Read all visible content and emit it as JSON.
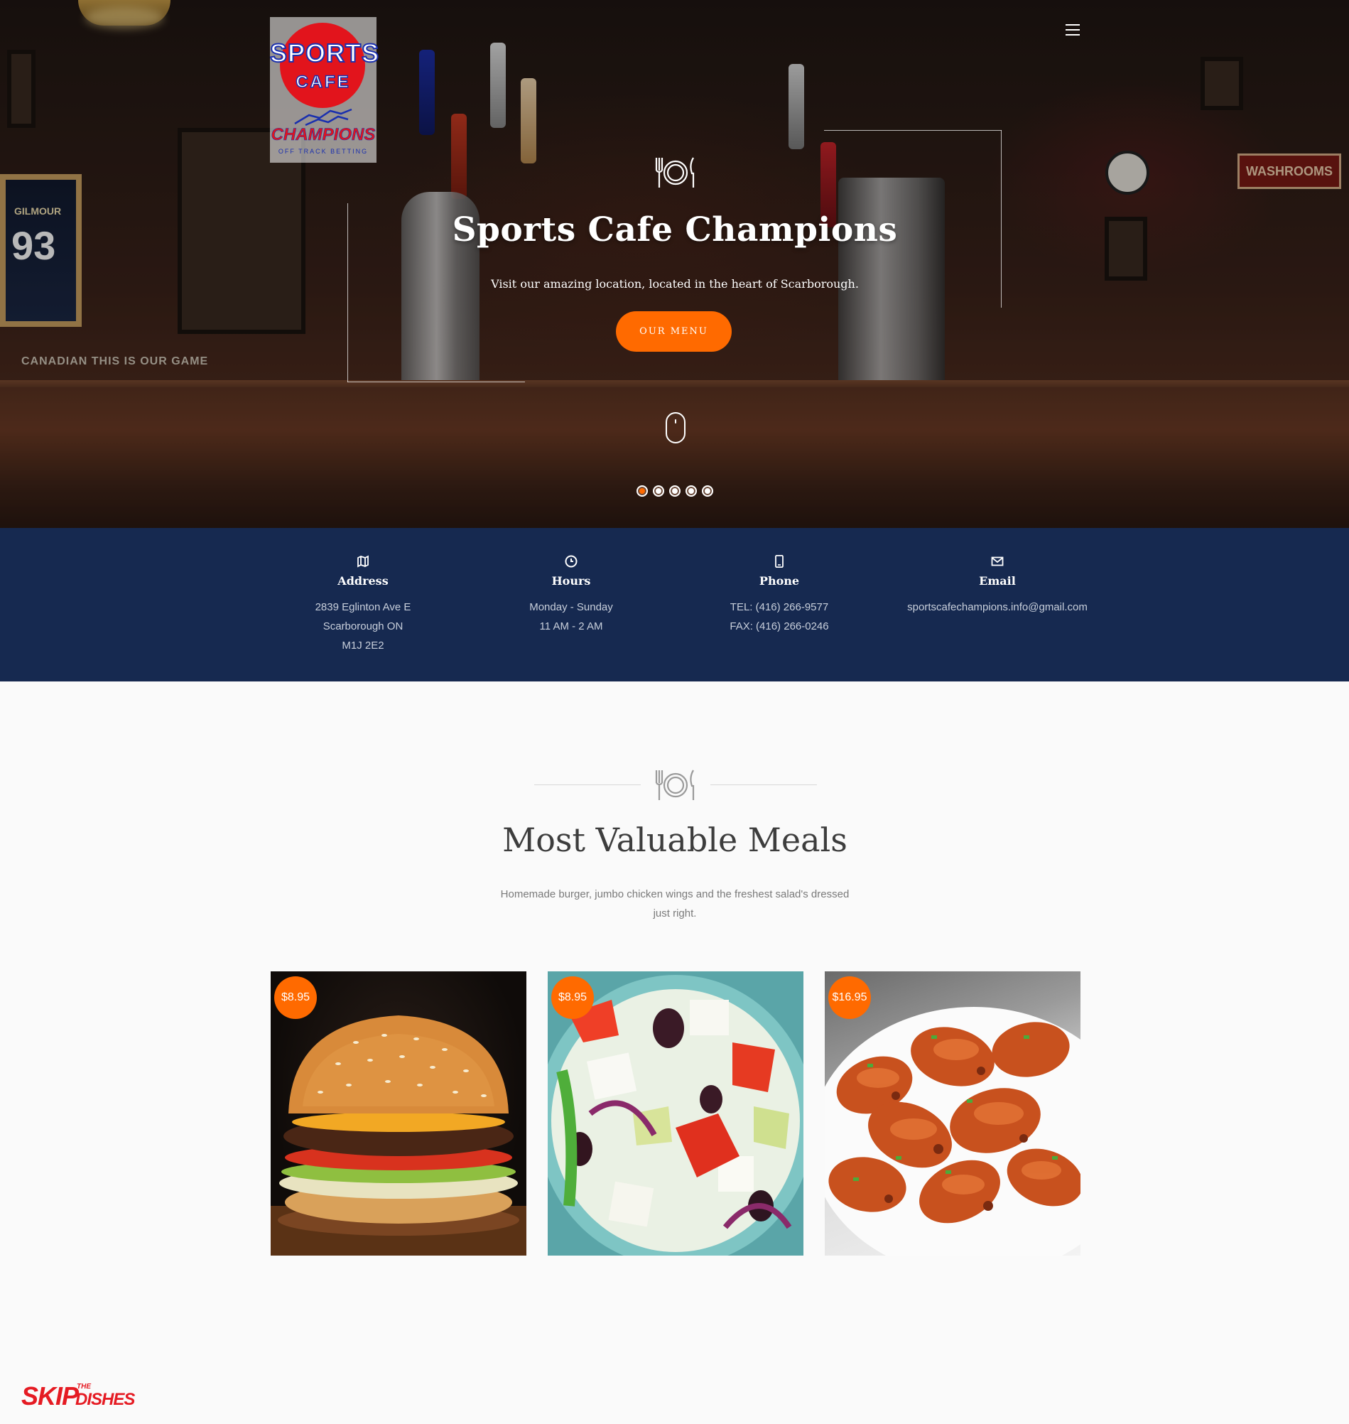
{
  "logo": {
    "line1": "SPORTS",
    "line2": "CAFE",
    "line3": "CHAMPIONS",
    "line4": "OFF TRACK BETTING"
  },
  "hero": {
    "title": "Sports Cafe Champions",
    "subtitle": "Visit our amazing location, located in the heart of Scarborough.",
    "button": "OUR MENU",
    "slide_count": 5,
    "active_slide": 1,
    "scenery_text": {
      "jersey_name": "GILMOUR",
      "jersey_number": "93",
      "sign": "WASHROOMS",
      "banner": "CANADIAN  THIS IS OUR GAME"
    }
  },
  "info": {
    "address": {
      "title": "Address",
      "lines": [
        "2839 Eglinton Ave E",
        "Scarborough ON",
        "M1J 2E2"
      ]
    },
    "hours": {
      "title": "Hours",
      "lines": [
        "Monday - Sunday",
        "11 AM - 2 AM"
      ]
    },
    "phone": {
      "title": "Phone",
      "lines": [
        "TEL: (416) 266-9577",
        "FAX: (416) 266-0246"
      ]
    },
    "email": {
      "title": "Email",
      "lines": [
        "sportscafechampions.info@gmail.com"
      ]
    }
  },
  "meals": {
    "title": "Most Valuable Meals",
    "subtitle_line1": "Homemade burger, jumbo chicken wings and the freshest salad's dressed",
    "subtitle_line2": "just right.",
    "items": [
      {
        "price": "$8.95",
        "image": "burger"
      },
      {
        "price": "$8.95",
        "image": "greek-salad"
      },
      {
        "price": "$16.95",
        "image": "chicken-wings"
      }
    ]
  },
  "skip": {
    "word1": "SKIP",
    "word2": "THE",
    "word3": "DISHES"
  },
  "colors": {
    "accent": "#ff6a00",
    "info_bg": "#162950",
    "skip_red": "#e51b23"
  },
  "icons": [
    "cutlery-plate-icon",
    "hamburger-menu-icon",
    "map-icon",
    "clock-icon",
    "mobile-phone-icon",
    "envelope-icon",
    "mouse-scroll-icon"
  ]
}
